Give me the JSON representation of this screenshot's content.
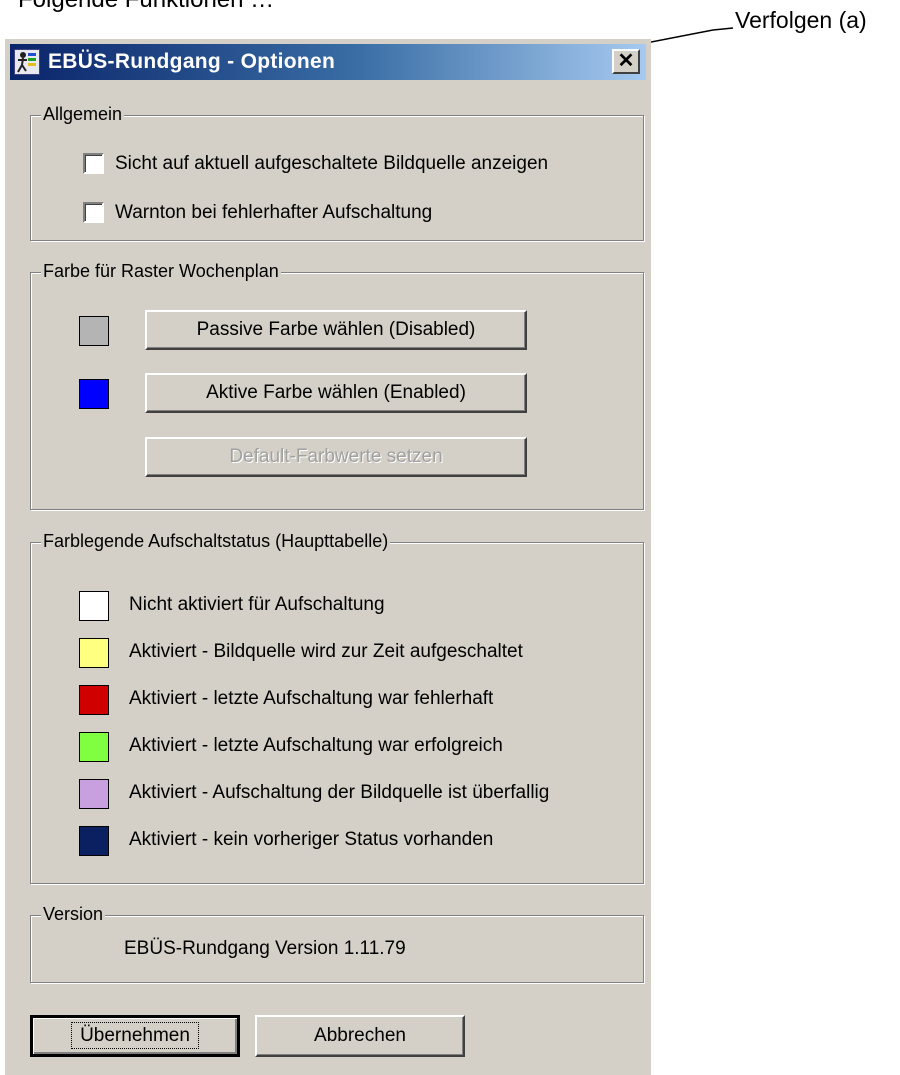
{
  "top_text": "Folgende Funktionen …",
  "callout": {
    "label": "Verfolgen (a)"
  },
  "window": {
    "title": "EBÜS-Rundgang  -  Optionen",
    "close_glyph": "✕"
  },
  "general": {
    "title": "Allgemein",
    "checkboxes": [
      {
        "label": "Sicht auf aktuell aufgeschaltete Bildquelle anzeigen",
        "checked": false
      },
      {
        "label": "Warnton bei fehlerhafter Aufschaltung",
        "checked": false
      }
    ]
  },
  "raster_color": {
    "title": "Farbe für Raster Wochenplan",
    "passive_color": "#b4b4b4",
    "active_color": "#0000ff",
    "passive_button": "Passive Farbe wählen (Disabled)",
    "active_button": "Aktive Farbe wählen (Enabled)",
    "default_button": "Default-Farbwerte setzen"
  },
  "legend": {
    "title": "Farblegende Aufschaltstatus (Haupttabelle)",
    "items": [
      {
        "color": "#ffffff",
        "label": "Nicht aktiviert für Aufschaltung"
      },
      {
        "color": "#ffff80",
        "label": "Aktiviert - Bildquelle wird zur Zeit aufgeschaltet"
      },
      {
        "color": "#d00000",
        "label": "Aktiviert - letzte Aufschaltung war fehlerhaft"
      },
      {
        "color": "#80ff40",
        "label": "Aktiviert - letzte Aufschaltung war erfolgreich"
      },
      {
        "color": "#c8a0e0",
        "label": "Aktiviert - Aufschaltung der Bildquelle ist überfallig"
      },
      {
        "color": "#0a2060",
        "label": "Aktiviert - kein vorheriger Status vorhanden"
      }
    ]
  },
  "version": {
    "title": "Version",
    "text": "EBÜS-Rundgang Version 1.11.79"
  },
  "buttons": {
    "apply": "Übernehmen",
    "cancel": "Abbrechen"
  }
}
